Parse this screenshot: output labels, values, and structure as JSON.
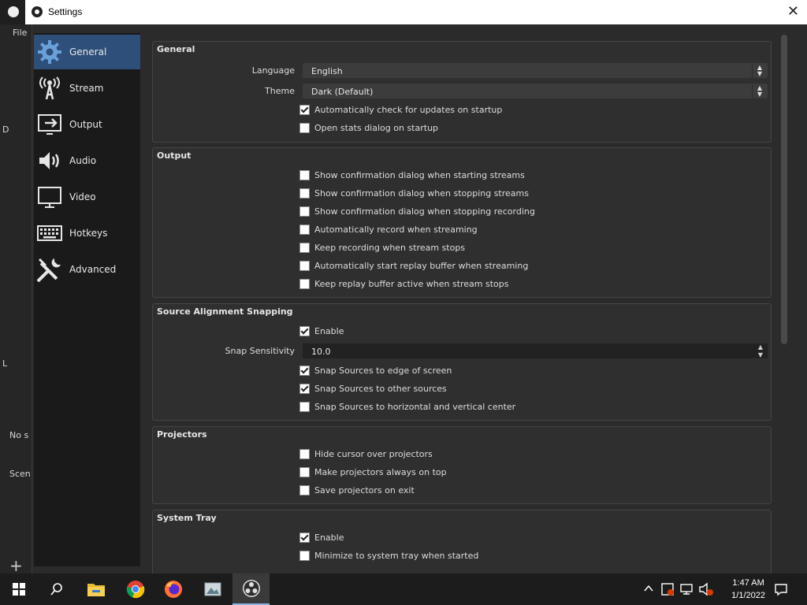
{
  "window": {
    "title": "Settings",
    "close_glyph": "✕"
  },
  "background": {
    "menu_file": "File",
    "sidebar_text_1": "No s",
    "sidebar_text_2": "Scen",
    "left_letter_1": "D",
    "left_letter_2": "L",
    "add_glyph": "+"
  },
  "nav": [
    {
      "label": "General",
      "icon": "gear-icon",
      "active": true
    },
    {
      "label": "Stream",
      "icon": "broadcast-tower-icon",
      "active": false
    },
    {
      "label": "Output",
      "icon": "output-monitor-icon",
      "active": false
    },
    {
      "label": "Audio",
      "icon": "speaker-icon",
      "active": false
    },
    {
      "label": "Video",
      "icon": "monitor-icon",
      "active": false
    },
    {
      "label": "Hotkeys",
      "icon": "keyboard-icon",
      "active": false
    },
    {
      "label": "Advanced",
      "icon": "tools-icon",
      "active": false
    }
  ],
  "general": {
    "title": "General",
    "language_label": "Language",
    "language_value": "English",
    "theme_label": "Theme",
    "theme_value": "Dark (Default)",
    "check_updates": {
      "label": "Automatically check for updates on startup",
      "checked": true
    },
    "open_stats": {
      "label": "Open stats dialog on startup",
      "checked": false
    }
  },
  "output": {
    "title": "Output",
    "items": [
      {
        "label": "Show confirmation dialog when starting streams",
        "checked": false
      },
      {
        "label": "Show confirmation dialog when stopping streams",
        "checked": false
      },
      {
        "label": "Show confirmation dialog when stopping recording",
        "checked": false
      },
      {
        "label": "Automatically record when streaming",
        "checked": false
      },
      {
        "label": "Keep recording when stream stops",
        "checked": false
      },
      {
        "label": "Automatically start replay buffer when streaming",
        "checked": false
      },
      {
        "label": "Keep replay buffer active when stream stops",
        "checked": false
      }
    ]
  },
  "snapping": {
    "title": "Source Alignment Snapping",
    "enable": {
      "label": "Enable",
      "checked": true
    },
    "sensitivity_label": "Snap Sensitivity",
    "sensitivity_value": "10.0",
    "items": [
      {
        "label": "Snap Sources to edge of screen",
        "checked": true
      },
      {
        "label": "Snap Sources to other sources",
        "checked": true
      },
      {
        "label": "Snap Sources to horizontal and vertical center",
        "checked": false
      }
    ]
  },
  "projectors": {
    "title": "Projectors",
    "items": [
      {
        "label": "Hide cursor over projectors",
        "checked": false
      },
      {
        "label": "Make projectors always on top",
        "checked": false
      },
      {
        "label": "Save projectors on exit",
        "checked": false
      }
    ]
  },
  "tray": {
    "title": "System Tray",
    "enable": {
      "label": "Enable",
      "checked": true
    },
    "minimize": {
      "label": "Minimize to system tray when started",
      "checked": false
    }
  },
  "taskbar": {
    "apps": [
      "windows-start-icon",
      "search-icon",
      "file-explorer-icon",
      "chrome-icon",
      "firefox-icon",
      "image-viewer-icon",
      "obs-icon"
    ],
    "time": "1:47 AM",
    "date": "1/1/2022",
    "colors": {
      "accent": "#2d4f7a",
      "taskbar_indicator": "#8ab4e6"
    }
  }
}
